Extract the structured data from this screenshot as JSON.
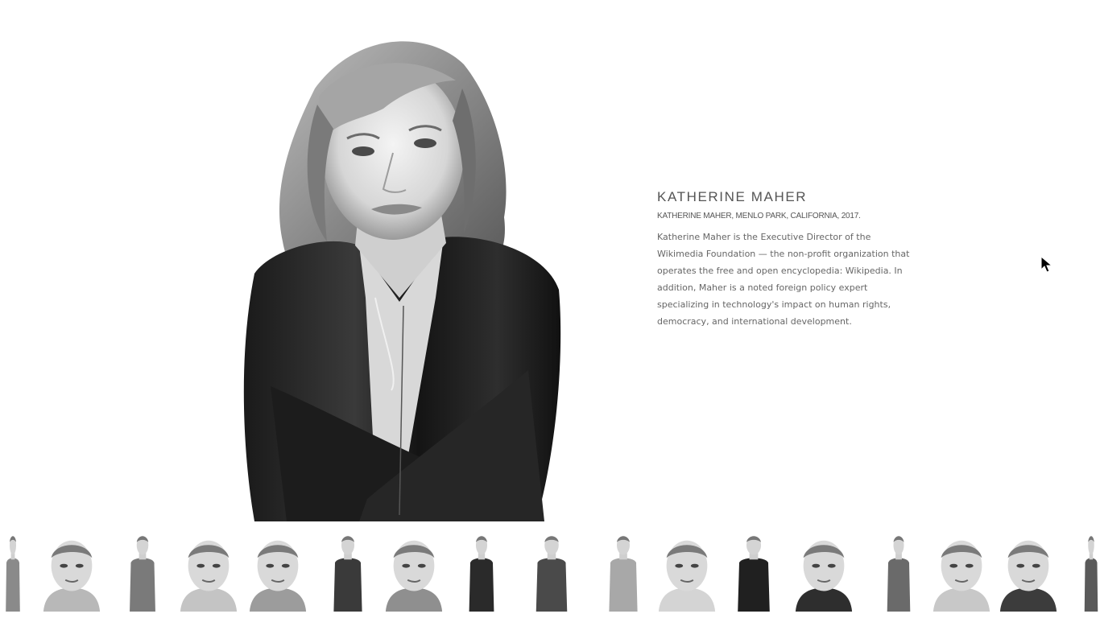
{
  "featured": {
    "name": "KATHERINE MAHER",
    "caption": "KATHERINE MAHER, MENLO PARK, CALIFORNIA, 2017.",
    "description": "Katherine Maher is the Executive Director of the Wikimedia Foundation — the non-profit organization that operates the free and open encyclopedia: Wikipedia. In addition, Maher is a noted foreign policy expert specializing in technology's impact on human rights, democracy, and international development."
  },
  "thumbnails": {
    "count": 17
  },
  "colors": {
    "text_heading": "#555555",
    "text_body": "#666666",
    "background": "#ffffff"
  },
  "icons": {
    "cursor": "arrow-cursor-icon"
  }
}
